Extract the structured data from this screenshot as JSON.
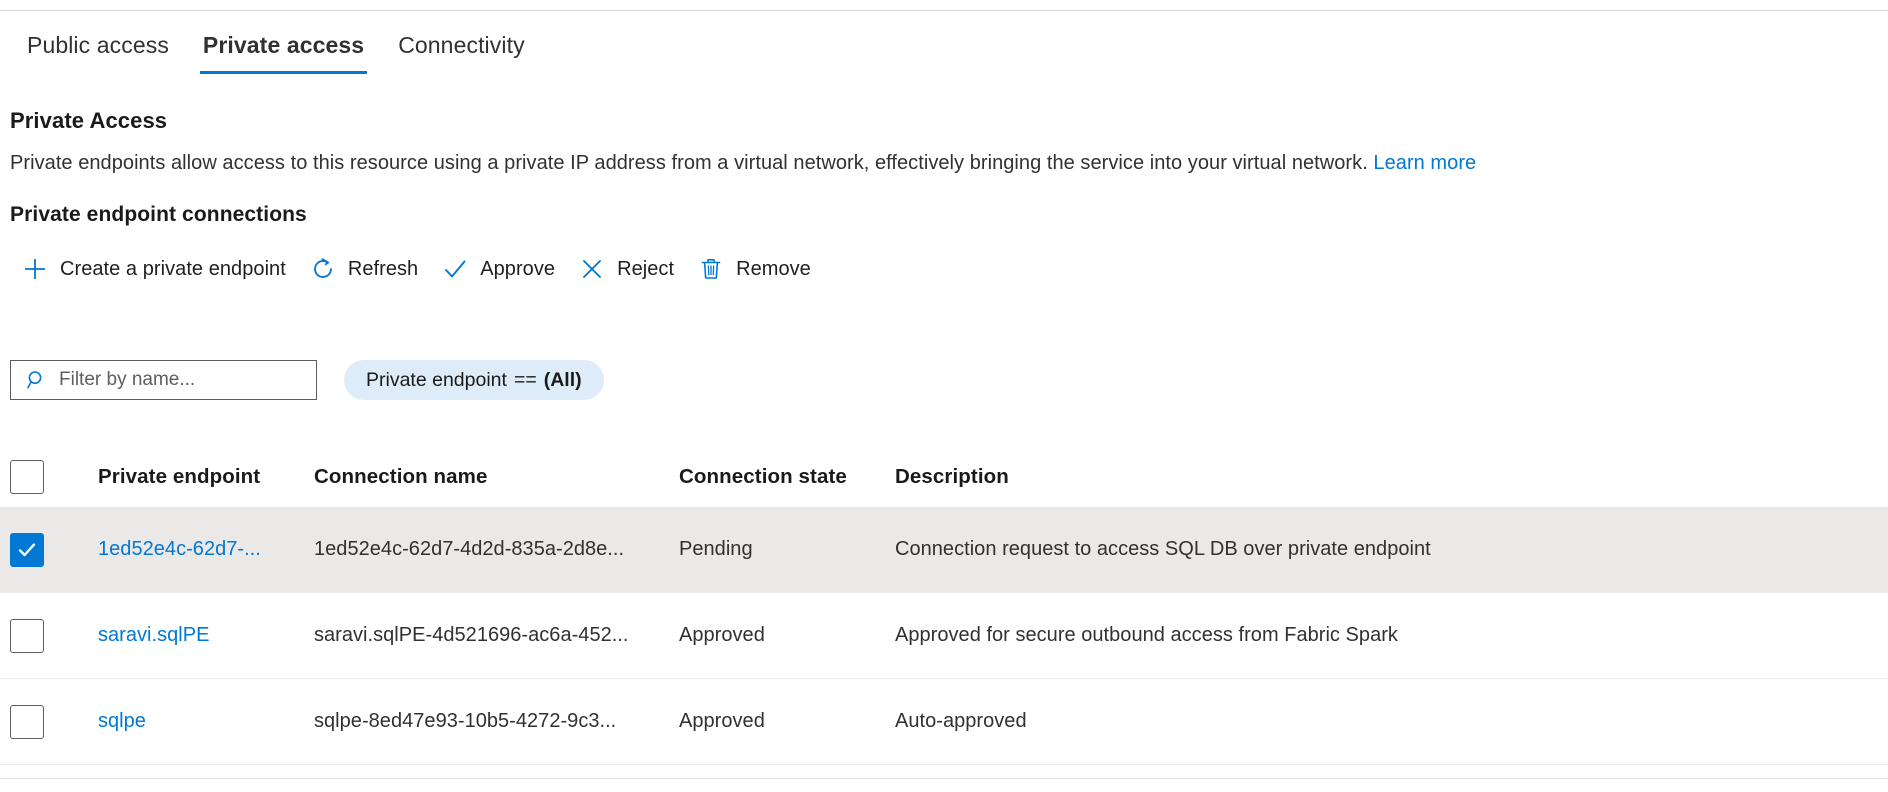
{
  "tabs": [
    {
      "label": "Public access",
      "selected": false
    },
    {
      "label": "Private access",
      "selected": true
    },
    {
      "label": "Connectivity",
      "selected": false
    }
  ],
  "section": {
    "title": "Private Access",
    "description": "Private endpoints allow access to this resource using a private IP address from a virtual network, effectively bringing the service into your virtual network.",
    "learn_more": "Learn more"
  },
  "connections": {
    "title": "Private endpoint connections",
    "commands": [
      {
        "label": "Create a private endpoint",
        "icon": "plus-icon"
      },
      {
        "label": "Refresh",
        "icon": "refresh-icon"
      },
      {
        "label": "Approve",
        "icon": "checkmark-icon"
      },
      {
        "label": "Reject",
        "icon": "cross-icon"
      },
      {
        "label": "Remove",
        "icon": "trash-icon"
      }
    ],
    "filter": {
      "search_placeholder": "Filter by name...",
      "search_value": "",
      "pill_field": "Private endpoint",
      "pill_operator": "==",
      "pill_value": "(All)"
    },
    "columns": [
      "Private endpoint",
      "Connection name",
      "Connection state",
      "Description"
    ],
    "select_all_checked": false,
    "rows": [
      {
        "checked": true,
        "selected": true,
        "private_endpoint": "1ed52e4c-62d7-...",
        "connection_name": "1ed52e4c-62d7-4d2d-835a-2d8e...",
        "connection_state": "Pending",
        "description": "Connection request to access SQL DB over private endpoint"
      },
      {
        "checked": false,
        "selected": false,
        "private_endpoint": "saravi.sqlPE",
        "connection_name": "saravi.sqlPE-4d521696-ac6a-452...",
        "connection_state": "Approved",
        "description": "Approved for secure outbound access from Fabric Spark"
      },
      {
        "checked": false,
        "selected": false,
        "private_endpoint": "sqlpe",
        "connection_name": "sqlpe-8ed47e93-10b5-4272-9c3...",
        "connection_state": "Approved",
        "description": "Auto-approved"
      }
    ]
  },
  "colors": {
    "accent": "#0078d4",
    "link": "#0078d4",
    "selected_row_bg": "#ebe9e7",
    "filter_pill_bg": "#deecf9"
  }
}
